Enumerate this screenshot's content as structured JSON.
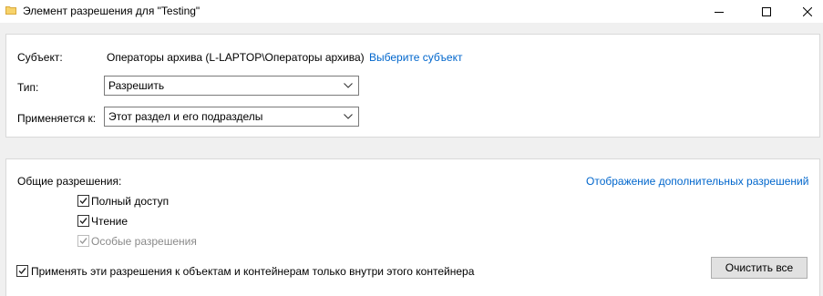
{
  "window": {
    "title": "Элемент разрешения для \"Testing\""
  },
  "principal": {
    "label": "Субъект:",
    "value": "Операторы архива (L-LAPTOP\\Операторы архива)",
    "select_link": "Выберите субъект"
  },
  "type": {
    "label": "Тип:",
    "value": "Разрешить"
  },
  "applies_to": {
    "label": "Применяется к:",
    "value": "Этот раздел и его подразделы"
  },
  "permissions": {
    "header": "Общие разрешения:",
    "advanced_link": "Отображение дополнительных разрешений",
    "items": [
      {
        "label": "Полный доступ",
        "checked": true,
        "enabled": true
      },
      {
        "label": "Чтение",
        "checked": true,
        "enabled": true
      },
      {
        "label": "Особые разрешения",
        "checked": true,
        "enabled": false
      }
    ]
  },
  "apply_inside": {
    "label": "Применять эти разрешения к объектам и контейнерам только внутри этого контейнера",
    "checked": true
  },
  "clear_all_button": "Очистить все",
  "icons": {
    "title_icon": "folder-icon",
    "minimize": "minimize-icon",
    "maximize": "maximize-icon",
    "close": "close-icon"
  },
  "colors": {
    "link": "#0066cc",
    "folder": "#f7d36b"
  }
}
